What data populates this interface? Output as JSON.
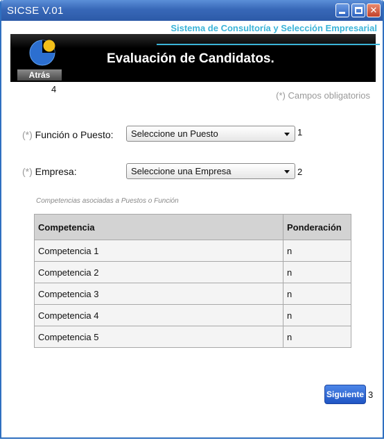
{
  "window": {
    "title": "SICSE V.01",
    "controls": {
      "minimize": "minimize",
      "maximize": "maximize",
      "close": "✕"
    }
  },
  "header": {
    "subtitle": "Sistema de Consultoría y Selección Empresarial",
    "title": "Evaluación de Candidatos.",
    "back_label": "Atrás",
    "back_marker": "4"
  },
  "form": {
    "required_note": "(*) Campos obligatorios",
    "required_mark": "(*)",
    "puesto": {
      "label": "Función o Puesto:",
      "value": "Seleccione un Puesto",
      "marker": "1"
    },
    "empresa": {
      "label": "Empresa:",
      "value": "Seleccione una Empresa",
      "marker": "2"
    }
  },
  "competencias": {
    "caption": "Competencias asociadas a Puestos o Función",
    "headers": [
      "Competencia",
      "Ponderación"
    ],
    "rows": [
      [
        "Competencia 1",
        "n"
      ],
      [
        "Competencia 2",
        "n"
      ],
      [
        "Competencia 3",
        "n"
      ],
      [
        "Competencia 4",
        "n"
      ],
      [
        "Competencia 5",
        "n"
      ]
    ]
  },
  "footer": {
    "next_label": "Siguiente",
    "next_marker": "3"
  },
  "colors": {
    "accent": "#3bb4d8",
    "titlebar": "#3868b8",
    "button": "#2d63c8"
  },
  "icons": {
    "logo": "pie-logo-icon"
  }
}
